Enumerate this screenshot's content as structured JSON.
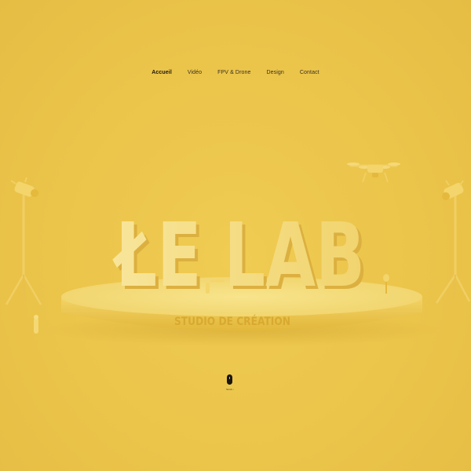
{
  "nav": {
    "items": [
      {
        "label": "Accueil",
        "active": true
      },
      {
        "label": "Vidéo",
        "active": false
      },
      {
        "label": "FPV & Drone",
        "active": false
      },
      {
        "label": "Design",
        "active": false
      },
      {
        "label": "Contact",
        "active": false
      }
    ]
  },
  "hero": {
    "logo_text": "ŁE LAB",
    "podium_text": "STUDIO DE CRÉATION"
  },
  "scroll": {
    "label": "Scroll ↓"
  },
  "colors": {
    "background": "#ecc64c",
    "letters": "#f6e08c",
    "podium": "#f1d56a",
    "nav_text": "#3a3120"
  }
}
